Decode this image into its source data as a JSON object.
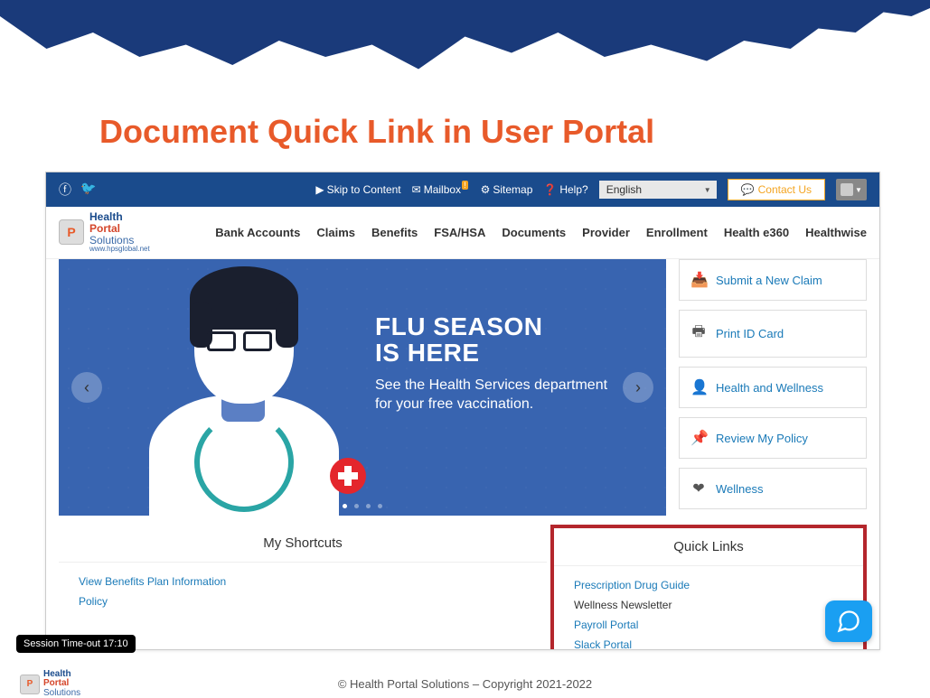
{
  "slide": {
    "title": "Document Quick Link in User Portal"
  },
  "topbar": {
    "skip": "Skip to Content",
    "mailbox": "Mailbox",
    "sitemap": "Sitemap",
    "help": "Help?",
    "language": "English",
    "contact": "Contact Us"
  },
  "logo": {
    "line1": "Health",
    "line2": "Portal",
    "line3": "Solutions",
    "url": "www.hpsglobal.net"
  },
  "nav": {
    "items": [
      "Bank Accounts",
      "Claims",
      "Benefits",
      "FSA/HSA",
      "Documents",
      "Provider",
      "Enrollment",
      "Health e360",
      "Healthwise"
    ]
  },
  "hero": {
    "title1": "FLU SEASON",
    "title2": "IS HERE",
    "body": "See the Health Services department for your free vaccination."
  },
  "sidecards": [
    {
      "icon": "📥",
      "label": "Submit a New Claim"
    },
    {
      "icon": "🖶",
      "label": "Print ID Card"
    },
    {
      "icon": "👤",
      "label": "Health and Wellness"
    },
    {
      "icon": "📌",
      "label": "Review My Policy"
    },
    {
      "icon": "❤",
      "label": "Wellness"
    }
  ],
  "shortcuts": {
    "title": "My Shortcuts",
    "items": [
      "View Benefits Plan Information",
      "Policy"
    ]
  },
  "quicklinks": {
    "title": "Quick Links",
    "items": [
      {
        "label": "Prescription Drug Guide",
        "muted": false
      },
      {
        "label": "Wellness Newsletter",
        "muted": true
      },
      {
        "label": "Payroll Portal",
        "muted": false
      },
      {
        "label": "Slack Portal",
        "muted": false
      }
    ]
  },
  "timeout": "Session Time-out 17:10",
  "footer": {
    "copyright": "© Health Portal Solutions – Copyright 2021-2022"
  }
}
